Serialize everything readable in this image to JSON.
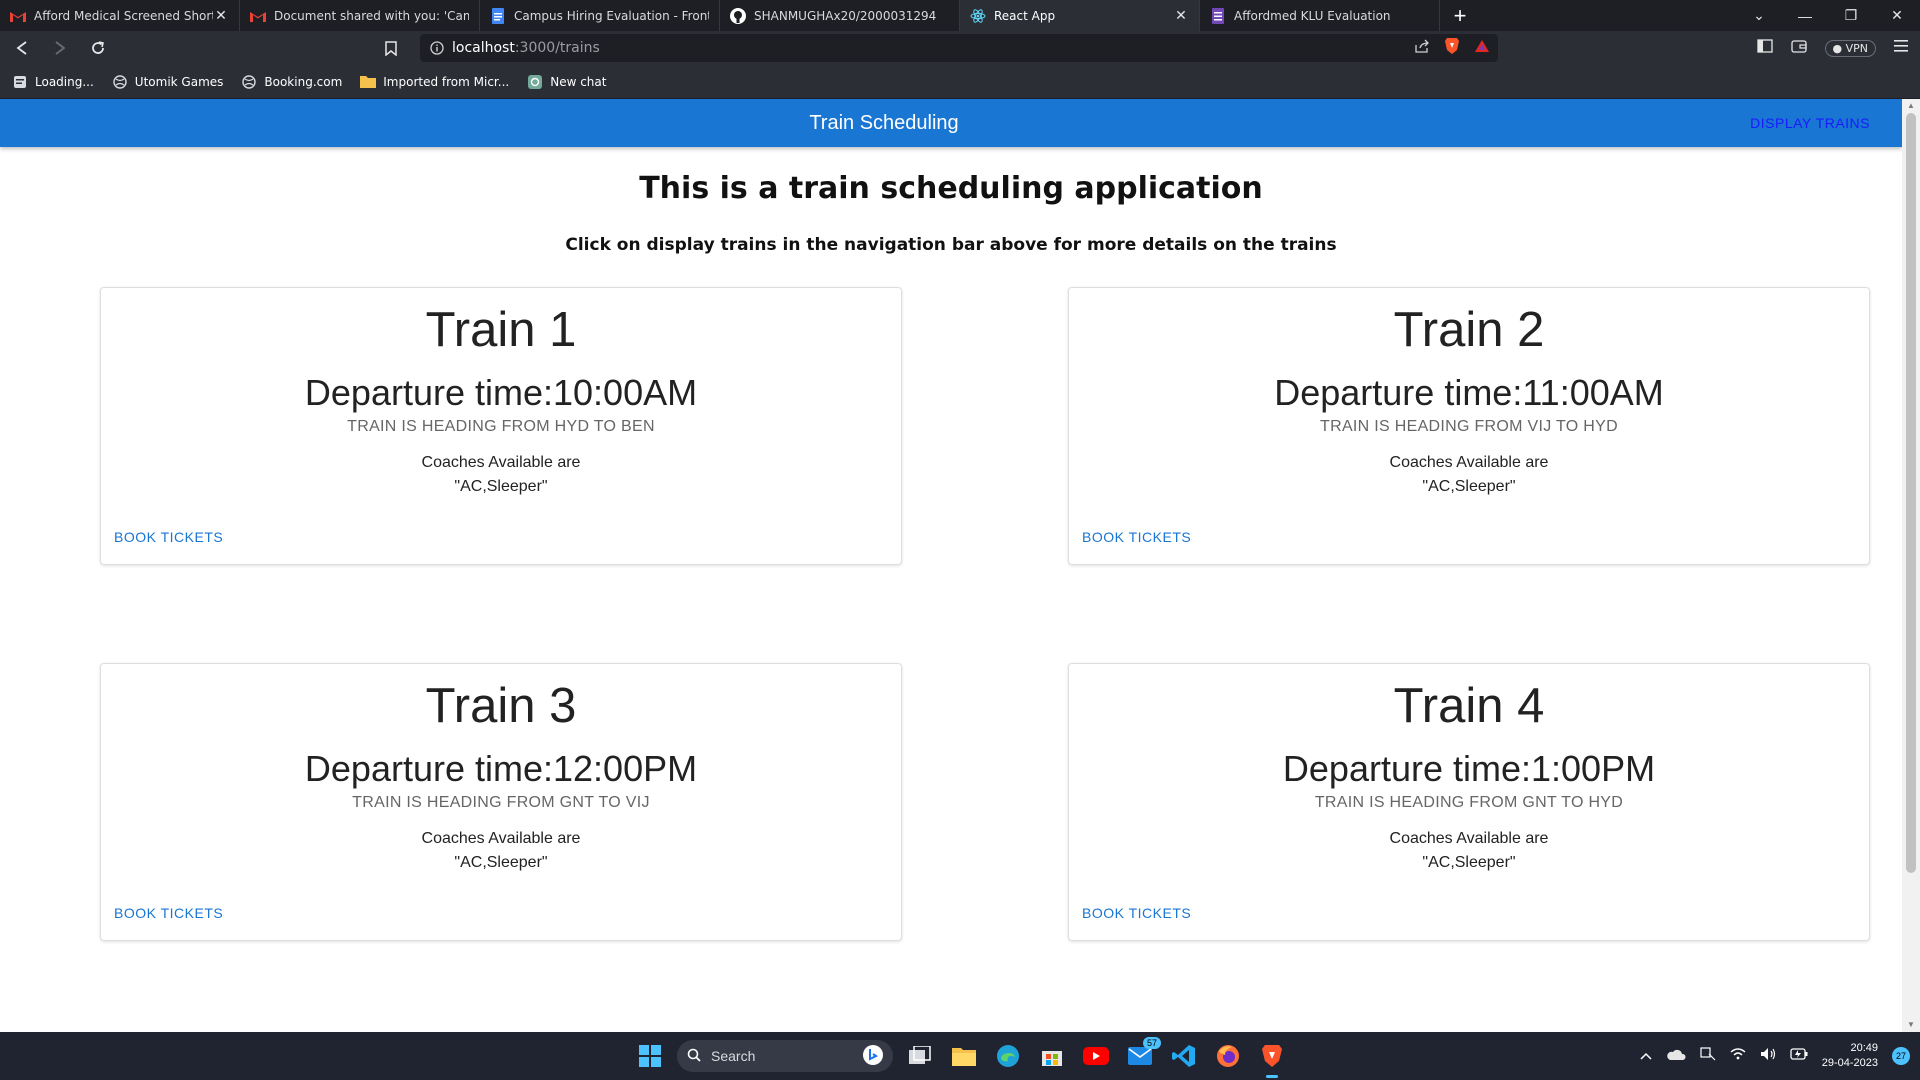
{
  "browser": {
    "tabs": [
      {
        "title": "Afford Medical Screened Shortlist",
        "icon": "gmail-icon",
        "active": false,
        "closable": true
      },
      {
        "title": "Document shared with you: 'Campus H",
        "icon": "gmail-icon",
        "active": false,
        "closable": false
      },
      {
        "title": "Campus Hiring Evaluation - Frontend",
        "icon": "docs-icon",
        "active": false,
        "closable": false
      },
      {
        "title": "SHANMUGHAx20/2000031294",
        "icon": "github-icon",
        "active": false,
        "closable": false
      },
      {
        "title": "React App",
        "icon": "react-icon",
        "active": true,
        "closable": true
      },
      {
        "title": "Affordmed KLU Evaluation",
        "icon": "forms-icon",
        "active": false,
        "closable": false
      }
    ],
    "new_tab_label": "+",
    "url": {
      "host": "localhost",
      "path": ":3000/trains"
    },
    "vpn_label": "VPN",
    "bookmarks": [
      {
        "label": "Loading...",
        "icon": "page-icon"
      },
      {
        "label": "Utomik Games",
        "icon": "globe-icon"
      },
      {
        "label": "Booking.com",
        "icon": "globe-icon"
      },
      {
        "label": "Imported from Micr...",
        "icon": "folder-icon"
      },
      {
        "label": "New chat",
        "icon": "chatgpt-icon"
      }
    ]
  },
  "app": {
    "title": "Train Scheduling",
    "nav_link": "DISPLAY TRAINS",
    "heading": "This is a train scheduling application",
    "subheading": "Click on display trains in the navigation bar above for more details on the trains",
    "trains": [
      {
        "name": "Train 1",
        "departure": "Departure time:10:00AM",
        "route": "TRAIN IS HEADING FROM HYD TO BEN",
        "coaches_label": "Coaches Available are",
        "coaches": "\"AC,Sleeper\"",
        "action": "BOOK TICKETS"
      },
      {
        "name": "Train 2",
        "departure": "Departure time:11:00AM",
        "route": "TRAIN IS HEADING FROM VIJ TO HYD",
        "coaches_label": "Coaches Available are",
        "coaches": "\"AC,Sleeper\"",
        "action": "BOOK TICKETS"
      },
      {
        "name": "Train 3",
        "departure": "Departure time:12:00PM",
        "route": "TRAIN IS HEADING FROM GNT TO VIJ",
        "coaches_label": "Coaches Available are",
        "coaches": "\"AC,Sleeper\"",
        "action": "BOOK TICKETS"
      },
      {
        "name": "Train 4",
        "departure": "Departure time:1:00PM",
        "route": "TRAIN IS HEADING FROM GNT TO HYD",
        "coaches_label": "Coaches Available are",
        "coaches": "\"AC,Sleeper\"",
        "action": "BOOK TICKETS"
      }
    ],
    "colors": {
      "appbar": "#1976d2",
      "nav_link": "#1a1aff",
      "action": "#1976d2"
    }
  },
  "taskbar": {
    "search_placeholder": "Search",
    "apps": [
      "file-explorer-icon",
      "edge-icon",
      "store-icon",
      "youtube-icon",
      "mail-icon",
      "vscode-icon",
      "firefox-icon",
      "brave-icon"
    ],
    "mail_badge": "57",
    "time": "20:49",
    "date": "29-04-2023",
    "notifications": "27"
  }
}
